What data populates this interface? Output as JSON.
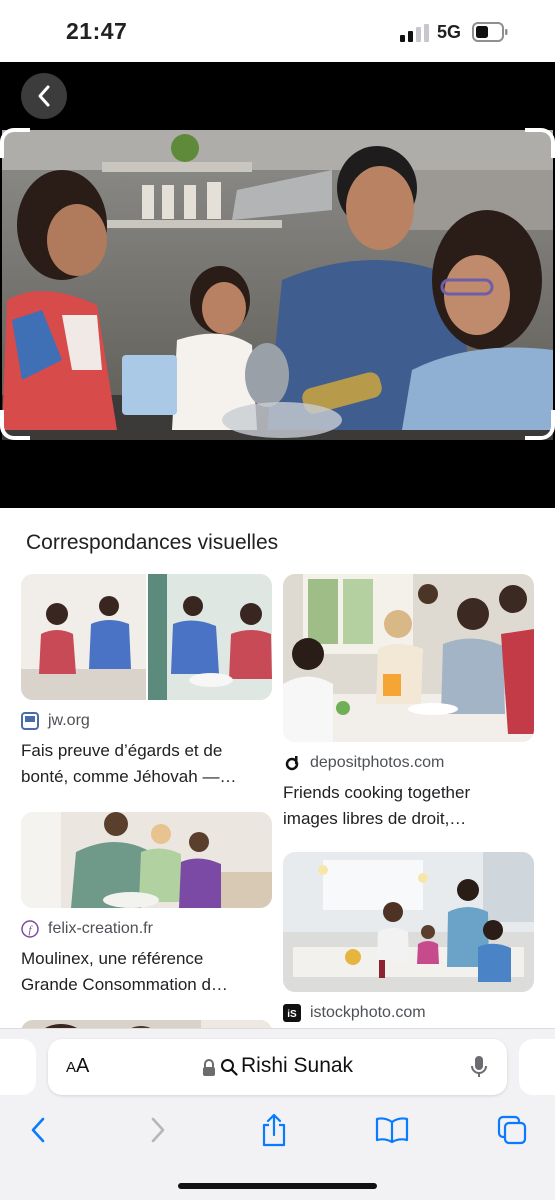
{
  "status_bar": {
    "time": "21:47",
    "network": "5G"
  },
  "viewer": {},
  "results": {
    "section_title": "Correspondances visuelles",
    "left_column": [
      {
        "source": "jw.org",
        "description": "Fais preuve d’égards et de bonté, comme Jéhovah —…",
        "favicon": "jw-icon"
      },
      {
        "source": "felix-creation.fr",
        "description": "Moulinex, une référence Grande Consommation d…",
        "favicon": "felix-icon"
      }
    ],
    "right_column": [
      {
        "source": "depositphotos.com",
        "description": "Friends cooking together images libres de droit,…",
        "favicon": "depositphotos-icon"
      },
      {
        "source": "istockphoto.com",
        "favicon": "istock-icon"
      }
    ]
  },
  "browser": {
    "text_size_label_small": "A",
    "text_size_label_large": "A",
    "query": "Rishi Sunak"
  },
  "colors": {
    "accent": "#1a73e8",
    "ios_blue": "#0a7aff",
    "text": "#202124",
    "secondary": "#4d5156"
  }
}
